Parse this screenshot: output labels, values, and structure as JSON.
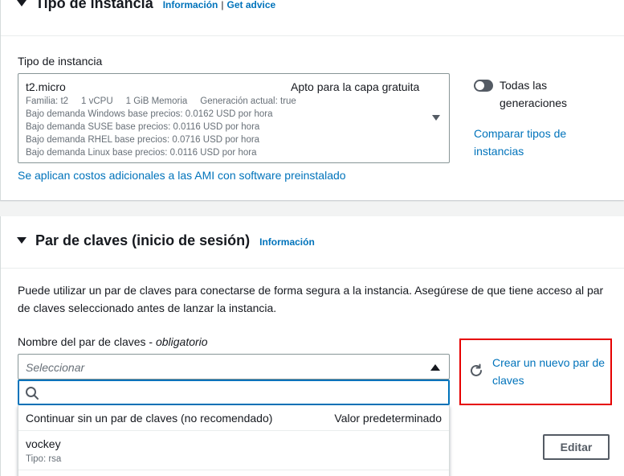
{
  "instance_section": {
    "title": "Tipo de instancia",
    "info_link": "Información",
    "separator": "|",
    "advice_link": "Get advice",
    "field_label": "Tipo de instancia",
    "selected": {
      "name": "t2.micro",
      "badge": "Apto para la capa gratuita",
      "details": [
        "Familia: t2     1 vCPU     1 GiB Memoria     Generación actual: true",
        "Bajo demanda Windows base precios: 0.0162 USD por hora",
        "Bajo demanda SUSE base precios: 0.0116 USD por hora",
        "Bajo demanda RHEL base precios: 0.0716 USD por hora",
        "Bajo demanda Linux base precios: 0.0116 USD por hora"
      ]
    },
    "toggle_label": "Todas las generaciones",
    "compare_link": "Comparar tipos de instancias",
    "ami_cost_link": "Se aplican costos adicionales a las AMI con software preinstalado"
  },
  "keypair_section": {
    "title": "Par de claves (inicio de sesión)",
    "info_link": "Información",
    "description": "Puede utilizar un par de claves para conectarse de forma segura a la instancia. Asegúrese de que tiene acceso al par de claves seleccionado antes de lanzar la instancia.",
    "field_label": "Nombre del par de claves - ",
    "field_required": "obligatorio",
    "select_placeholder": "Seleccionar",
    "search_value": "",
    "options": [
      {
        "label": "Continuar sin un par de claves (no recomendado)",
        "tag": "Valor predeterminado"
      },
      {
        "label": "vockey",
        "sub": "Tipo: rsa"
      }
    ],
    "create_link": "Crear un nuevo par de claves"
  },
  "edit_button": "Editar",
  "colors": {
    "link": "#0073bb",
    "highlight_box": "#e60000",
    "toggle_off": "#545b64"
  }
}
